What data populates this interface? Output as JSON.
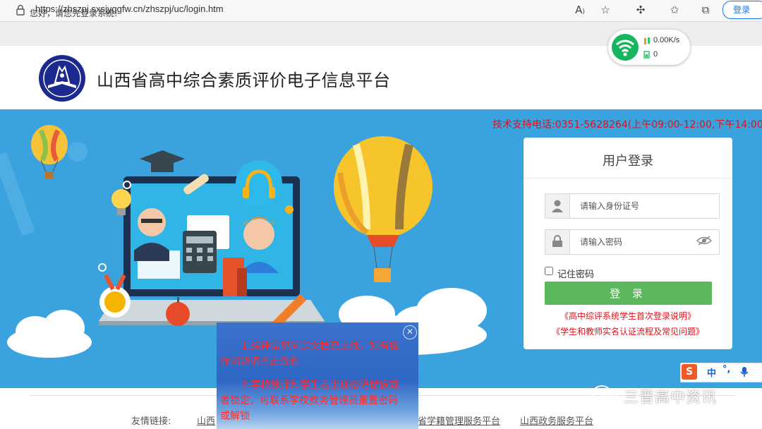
{
  "browser": {
    "url": "https://zhszpj.sxsjyggfw.cn/zhszpj/uc/login.htm",
    "login_label": "登录",
    "icons": [
      "lock-icon",
      "read-aloud-icon",
      "add-favorite-icon",
      "extensions-icon",
      "favorites-icon",
      "collections-icon"
    ]
  },
  "header": {
    "greeting": "您好，请您先登录系统!",
    "title": "山西省高中综合素质评价电子信息平台"
  },
  "wifi_widget": {
    "speed": "0.00K/s",
    "count": "0"
  },
  "banner": {
    "support_phone": "技术支持电话:0351-5628264(上午09:00-12:00,下午14:00-18:"
  },
  "login": {
    "title": "用户登录",
    "id_placeholder": "请输入身份证号",
    "password_placeholder": "请输入密码",
    "remember_label": "记住密码",
    "submit_label": "登 录",
    "links": [
      "《高中综评系统学生首次登录说明》",
      "《学生和教师实名认证流程及常见问题》"
    ]
  },
  "notice": {
    "line1": "1.综评常见问题文档已上线，如有操作问题请点击查看",
    "line2": "2.学校教师和学生若出现密码错误或者锁定，可联系学校教务管理员重置密码或解锁"
  },
  "footer": {
    "label": "友情链接:",
    "links": [
      "山西",
      "省学籍管理服务平台",
      "山西政务服务平台"
    ]
  },
  "tray": {
    "ime_logo": "S",
    "ime_lang": "中",
    "ime_punct": "°,",
    "watermark": "三晋高中资讯"
  },
  "colors": {
    "banner_blue": "#3aa3de",
    "login_green": "#5cb85c",
    "alert_red": "#e0101c"
  }
}
